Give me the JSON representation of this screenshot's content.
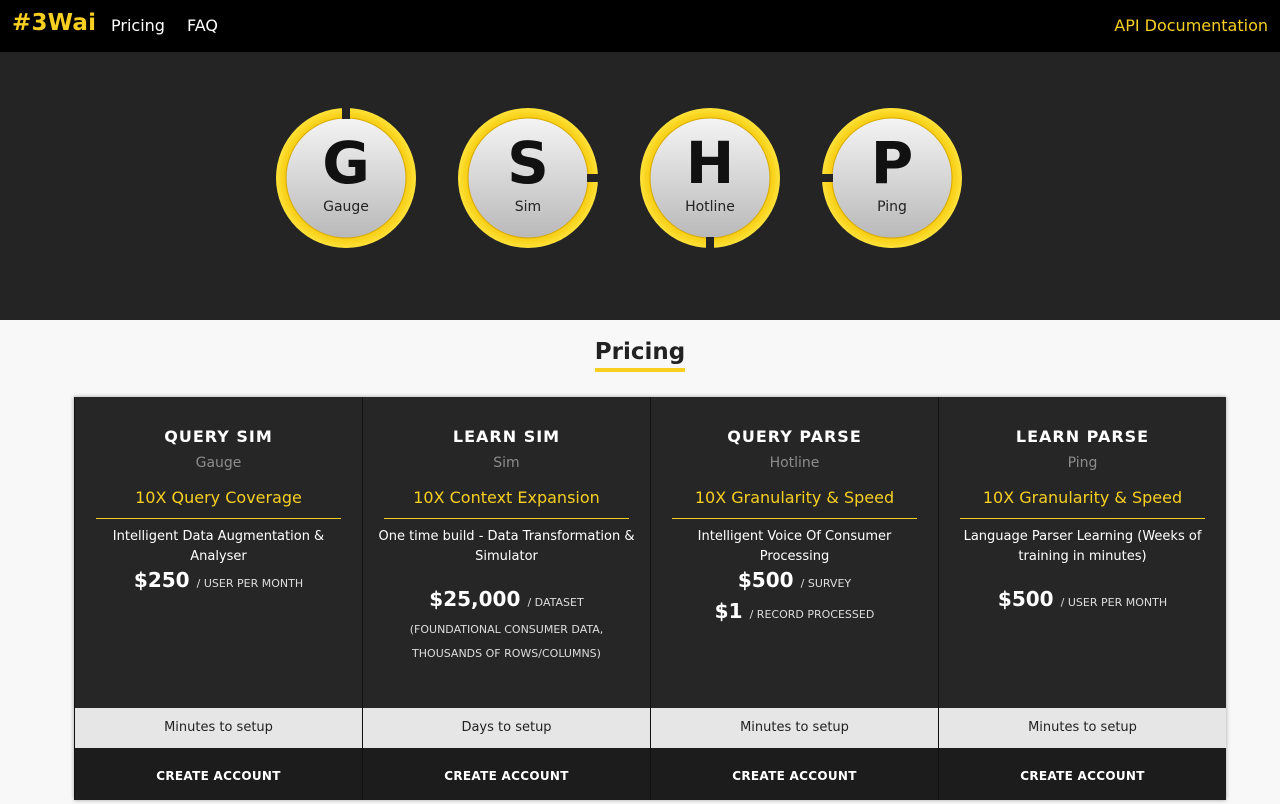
{
  "header": {
    "brand": "#3Wai",
    "nav": {
      "pricing": "Pricing",
      "faq": "FAQ"
    },
    "api_docs": "API Documentation"
  },
  "hero": {
    "badges": [
      {
        "letter": "G",
        "name": "Gauge"
      },
      {
        "letter": "S",
        "name": "Sim"
      },
      {
        "letter": "H",
        "name": "Hotline"
      },
      {
        "letter": "P",
        "name": "Ping"
      }
    ]
  },
  "pricing": {
    "title": "Pricing",
    "plans": [
      {
        "name": "QUERY SIM",
        "product": "Gauge",
        "tagline": "10X Query Coverage",
        "description": "Intelligent Data Augmentation & Analyser",
        "price1_amount": "$250",
        "price1_unit": "/ USER PER MONTH",
        "setup": "Minutes to setup",
        "cta": "CREATE ACCOUNT"
      },
      {
        "name": "LEARN SIM",
        "product": "Sim",
        "tagline": "10X Context Expansion",
        "description": "One time build - Data Transformation & Simulator",
        "price1_amount": "$25,000",
        "price1_unit": "/ DATASET",
        "price1_note": "(FOUNDATIONAL CONSUMER DATA, THOUSANDS OF ROWS/COLUMNS)",
        "setup": "Days to setup",
        "cta": "CREATE ACCOUNT"
      },
      {
        "name": "QUERY PARSE",
        "product": "Hotline",
        "tagline": "10X Granularity & Speed",
        "description": "Intelligent Voice Of Consumer Processing",
        "price1_amount": "$500",
        "price1_unit": "/ SURVEY",
        "price2_amount": "$1",
        "price2_unit": "/ RECORD PROCESSED",
        "setup": "Minutes to setup",
        "cta": "CREATE ACCOUNT"
      },
      {
        "name": "LEARN PARSE",
        "product": "Ping",
        "tagline": "10X Granularity & Speed",
        "description": "Language Parser Learning (Weeks of training in minutes)",
        "price1_amount": "$500",
        "price1_unit": "/ USER PER MONTH",
        "setup": "Minutes to setup",
        "cta": "CREATE ACCOUNT"
      }
    ]
  },
  "colors": {
    "accent": "#f6cf21",
    "header_bg": "#000000",
    "hero_bg": "#242424",
    "card_bg": "#262626"
  }
}
